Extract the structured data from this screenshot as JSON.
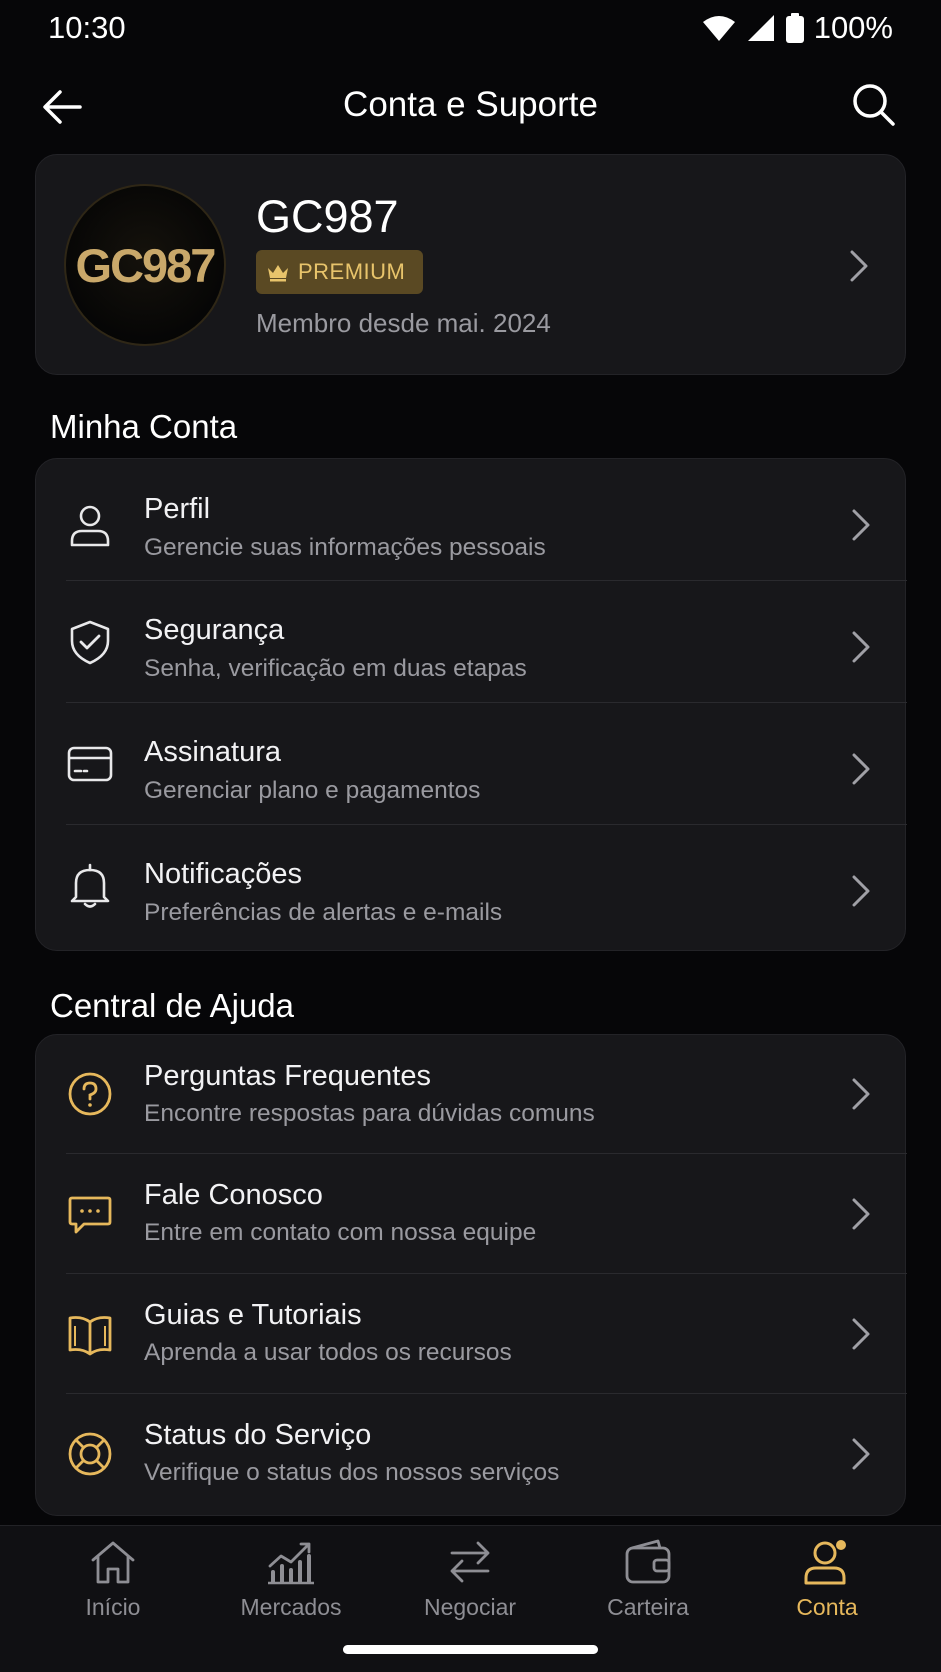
{
  "status_bar": {
    "time": "10:30",
    "battery": "100%",
    "icons": [
      "wifi-icon",
      "signal-icon",
      "battery-icon"
    ]
  },
  "app_bar": {
    "title": "Conta e Suporte",
    "back_icon": "arrow-left-icon",
    "search_icon": "search-icon"
  },
  "profile": {
    "avatar_text": "GC987",
    "name": "GC987",
    "badge": "PREMIUM",
    "badge_icon": "crown-icon",
    "member_since": "Membro desde mai. 2024"
  },
  "account_section": {
    "title": "Minha Conta",
    "items": [
      {
        "title": "Perfil",
        "subtitle": "Gerencie suas informações pessoais",
        "icon": "user-icon"
      },
      {
        "title": "Segurança",
        "subtitle": "Senha, verificação em duas etapas",
        "icon": "shield-check-icon"
      },
      {
        "title": "Assinatura",
        "subtitle": "Gerenciar plano e pagamentos",
        "icon": "credit-card-icon"
      },
      {
        "title": "Notificações",
        "subtitle": "Preferências de alertas e e-mails",
        "icon": "bell-icon"
      }
    ]
  },
  "help_section": {
    "title": "Central de Ajuda",
    "items": [
      {
        "title": "Perguntas Frequentes",
        "subtitle": "Encontre respostas para dúvidas comuns",
        "icon": "question-circle-icon"
      },
      {
        "title": "Fale Conosco",
        "subtitle": "Entre em contato com nossa equipe",
        "icon": "chat-icon"
      },
      {
        "title": "Guias e Tutoriais",
        "subtitle": "Aprenda a usar todos os recursos",
        "icon": "book-icon"
      },
      {
        "title": "Status do Serviço",
        "subtitle": "Verifique o status dos nossos serviços",
        "icon": "lifebuoy-icon"
      }
    ]
  },
  "bottom_nav": {
    "items": [
      {
        "label": "Início",
        "icon": "home-icon"
      },
      {
        "label": "Mercados",
        "icon": "chart-icon"
      },
      {
        "label": "Negociar",
        "icon": "swap-icon"
      },
      {
        "label": "Carteira",
        "icon": "wallet-icon"
      },
      {
        "label": "Conta",
        "icon": "account-icon",
        "active": true
      }
    ]
  },
  "colors": {
    "background": "#060608",
    "card": "#17171a",
    "accent_gold": "#e6b85c",
    "muted_text": "#9a9aa0"
  }
}
